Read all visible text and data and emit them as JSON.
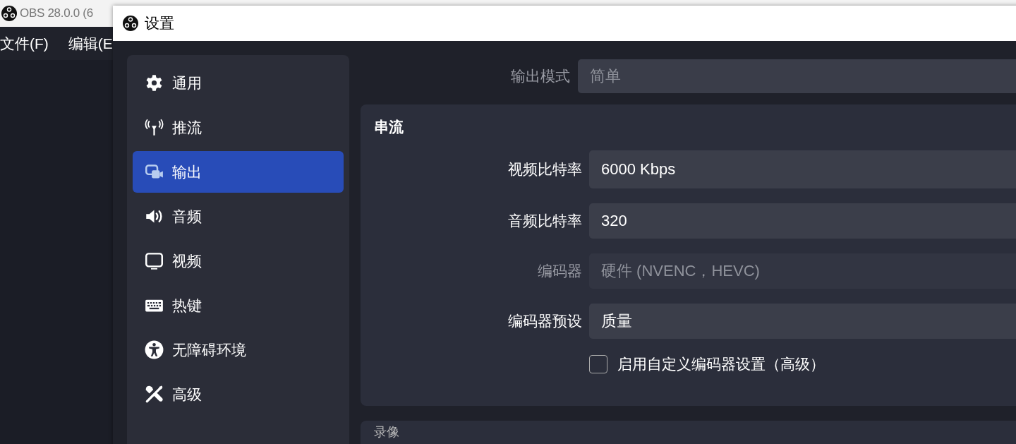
{
  "main_window": {
    "title": "OBS 28.0.0 (6",
    "menu": [
      "文件(F)",
      "编辑(E"
    ]
  },
  "settings_window": {
    "title": "设置",
    "sidebar": {
      "items": [
        {
          "label": "通用",
          "kind": "gear",
          "selected": false
        },
        {
          "label": "推流",
          "kind": "antenna",
          "selected": false
        },
        {
          "label": "输出",
          "kind": "output",
          "selected": true
        },
        {
          "label": "音频",
          "kind": "speaker",
          "selected": false
        },
        {
          "label": "视频",
          "kind": "monitor",
          "selected": false
        },
        {
          "label": "热键",
          "kind": "keyboard",
          "selected": false
        },
        {
          "label": "无障碍环境",
          "kind": "accessibility",
          "selected": false
        },
        {
          "label": "高级",
          "kind": "tools",
          "selected": false
        }
      ]
    },
    "output_mode": {
      "label": "输出模式",
      "value": "简单",
      "disabled": true
    },
    "sections": [
      {
        "title": "串流",
        "fields": [
          {
            "kind": "field",
            "label": "视频比特率",
            "value": "6000 Kbps",
            "disabled": false
          },
          {
            "kind": "field",
            "label": "音频比特率",
            "value": "320",
            "disabled": false
          },
          {
            "kind": "field",
            "label": "编码器",
            "value": "硬件 (NVENC，HEVC)",
            "disabled": true
          },
          {
            "kind": "field",
            "label": "编码器预设",
            "value": "质量",
            "disabled": false
          },
          {
            "kind": "checkbox",
            "label": "启用自定义编码器设置（高级）",
            "checked": false
          }
        ]
      },
      {
        "title": "录像"
      }
    ]
  }
}
